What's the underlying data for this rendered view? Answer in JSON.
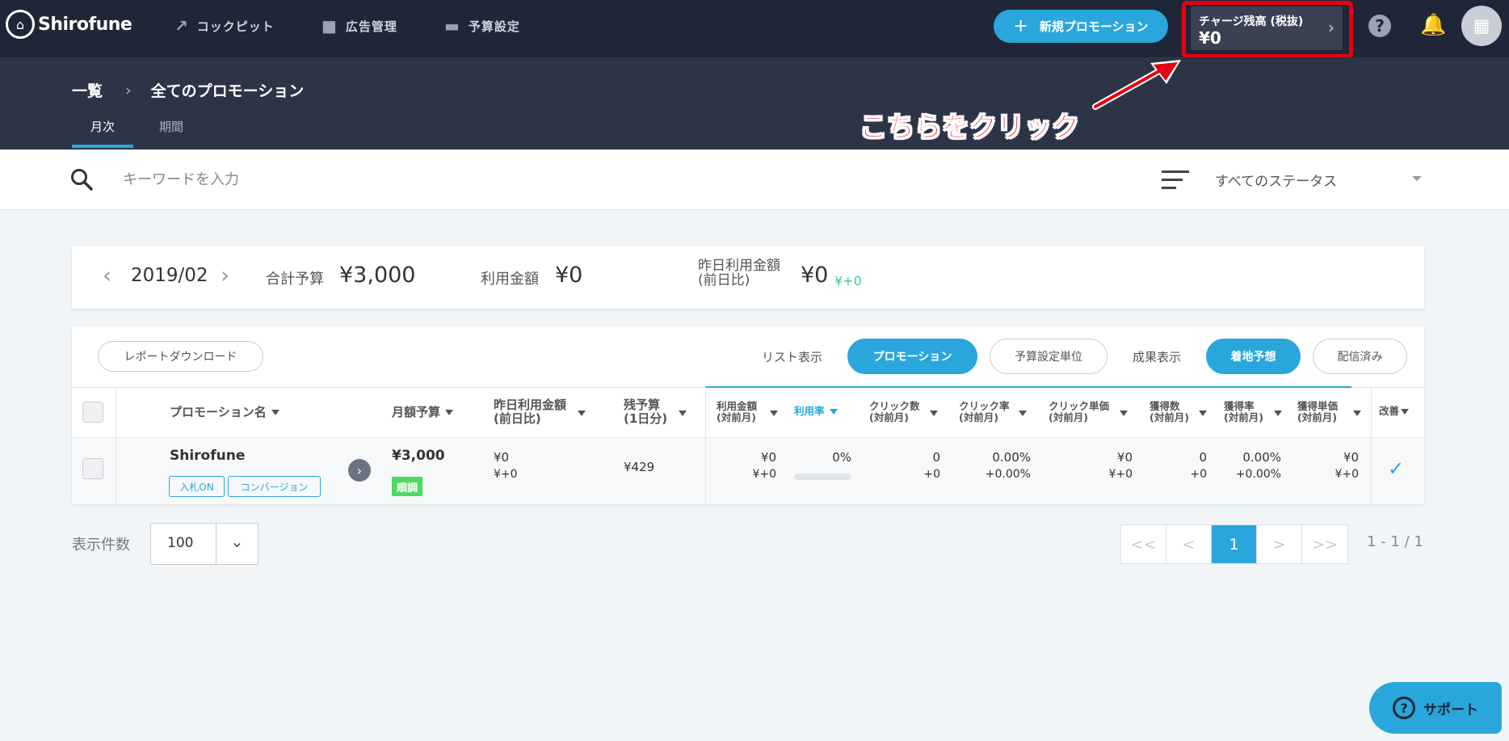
{
  "app": {
    "name": "Shirofune"
  },
  "nav": {
    "items": [
      {
        "label": "コックピット",
        "icon": "trending-up-icon"
      },
      {
        "label": "広告管理",
        "icon": "folder-icon"
      },
      {
        "label": "予算設定",
        "icon": "wallet-icon"
      }
    ],
    "new_promotion": "新規プロモーション",
    "charge_label": "チャージ残高 (税抜)",
    "charge_value": "¥0"
  },
  "breadcrumb": {
    "root": "一覧",
    "current": "全てのプロモーション"
  },
  "tabs": [
    {
      "label": "月次",
      "active": true
    },
    {
      "label": "期間",
      "active": false
    }
  ],
  "annotation": {
    "text": "こちらをクリック",
    "color": "#e60012"
  },
  "search": {
    "placeholder": "キーワードを入力",
    "value": ""
  },
  "status_filter": {
    "selected": "すべてのステータス"
  },
  "summary": {
    "month": "2019/02",
    "total_budget_label": "合計予算",
    "total_budget": "¥3,000",
    "spend_label": "利用金額",
    "spend": "¥0",
    "yesterday_label_1": "昨日利用金額",
    "yesterday_label_2": "(前日比)",
    "yesterday": "¥0",
    "yesterday_diff": "¥+0"
  },
  "toolbar": {
    "report_download": "レポートダウンロード",
    "list_view_label": "リスト表示",
    "list_promotion": "プロモーション",
    "list_budget_unit": "予算設定単位",
    "result_view_label": "成果表示",
    "result_forecast": "着地予想",
    "result_delivered": "配信済み"
  },
  "columns": {
    "name": "プロモーション名",
    "monthly_budget": "月額予算",
    "yesterday_spend_1": "昨日利用金額",
    "yesterday_spend_2": "(前日比)",
    "remaining_1": "残予算",
    "remaining_2": "(1日分)",
    "spend_1": "利用金額",
    "spend_2": "(対前月)",
    "usage_rate": "利用率",
    "clicks_1": "クリック数",
    "clicks_2": "(対前月)",
    "ctr_1": "クリック率",
    "ctr_2": "(対前月)",
    "cpc_1": "クリック単価",
    "cpc_2": "(対前月)",
    "conv_1": "獲得数",
    "conv_2": "(対前月)",
    "cvr_1": "獲得率",
    "cvr_2": "(対前月)",
    "cpa_1": "獲得単価",
    "cpa_2": "(対前月)",
    "improve": "改善"
  },
  "rows": [
    {
      "name": "Shirofune",
      "tag_bid": "入札ON",
      "tag_conv": "コンバージョン",
      "monthly_budget": "¥3,000",
      "status": "順調",
      "yesterday_spend": "¥0",
      "yesterday_diff": "¥+0",
      "remaining": "¥429",
      "spend": "¥0",
      "spend_diff": "¥+0",
      "usage_rate": "0%",
      "usage_rate_value": 0,
      "clicks": "0",
      "clicks_diff": "+0",
      "ctr": "0.00%",
      "ctr_diff": "+0.00%",
      "cpc": "¥0",
      "cpc_diff": "¥+0",
      "conv": "0",
      "conv_diff": "+0",
      "cvr": "0.00%",
      "cvr_diff": "+0.00%",
      "cpa": "¥0",
      "cpa_diff": "¥+0"
    }
  ],
  "pagination": {
    "per_page_label": "表示件数",
    "per_page": "100",
    "first": "<<",
    "prev": "<",
    "current": "1",
    "next": ">",
    "last": ">>",
    "range": "1 - 1 / 1"
  },
  "support": {
    "label": "サポート"
  }
}
